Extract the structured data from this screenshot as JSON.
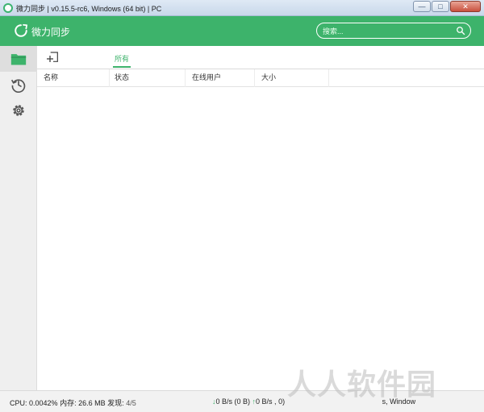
{
  "window": {
    "title": "微力同步 | v0.15.5-rc6, Windows (64 bit) | PC",
    "minimize_label": "—",
    "maximize_label": "□",
    "close_label": "✕"
  },
  "appbar": {
    "brand_name": "微力同步",
    "brand_icon": "sync-icon",
    "search_placeholder": "搜索...",
    "search_icon": "search-icon",
    "accent_color": "#3db36b"
  },
  "sidebar": {
    "items": [
      {
        "name": "folder",
        "icon": "folder-icon",
        "active": true
      },
      {
        "name": "history",
        "icon": "history-icon",
        "active": false
      },
      {
        "name": "settings",
        "icon": "gear-icon",
        "active": false
      }
    ]
  },
  "toolbar": {
    "add_icon": "add-folder-icon",
    "tabs": [
      {
        "label": "所有",
        "active": true
      }
    ]
  },
  "table": {
    "columns": [
      "名称",
      "状态",
      "在线用户",
      "大小"
    ],
    "rows": []
  },
  "status": {
    "cpu_label": "CPU:",
    "cpu_value": "0.0042%",
    "memory_label": "内存:",
    "memory_value": "26.6 MB",
    "discovery_label": "发现:",
    "discovery_value": "4/5",
    "download": "0 B/s (0 B)",
    "upload": "0 B/s ,",
    "upload_tail": "0)",
    "os_partial": "s, Window"
  },
  "watermark": {
    "text": "人人软件园"
  }
}
